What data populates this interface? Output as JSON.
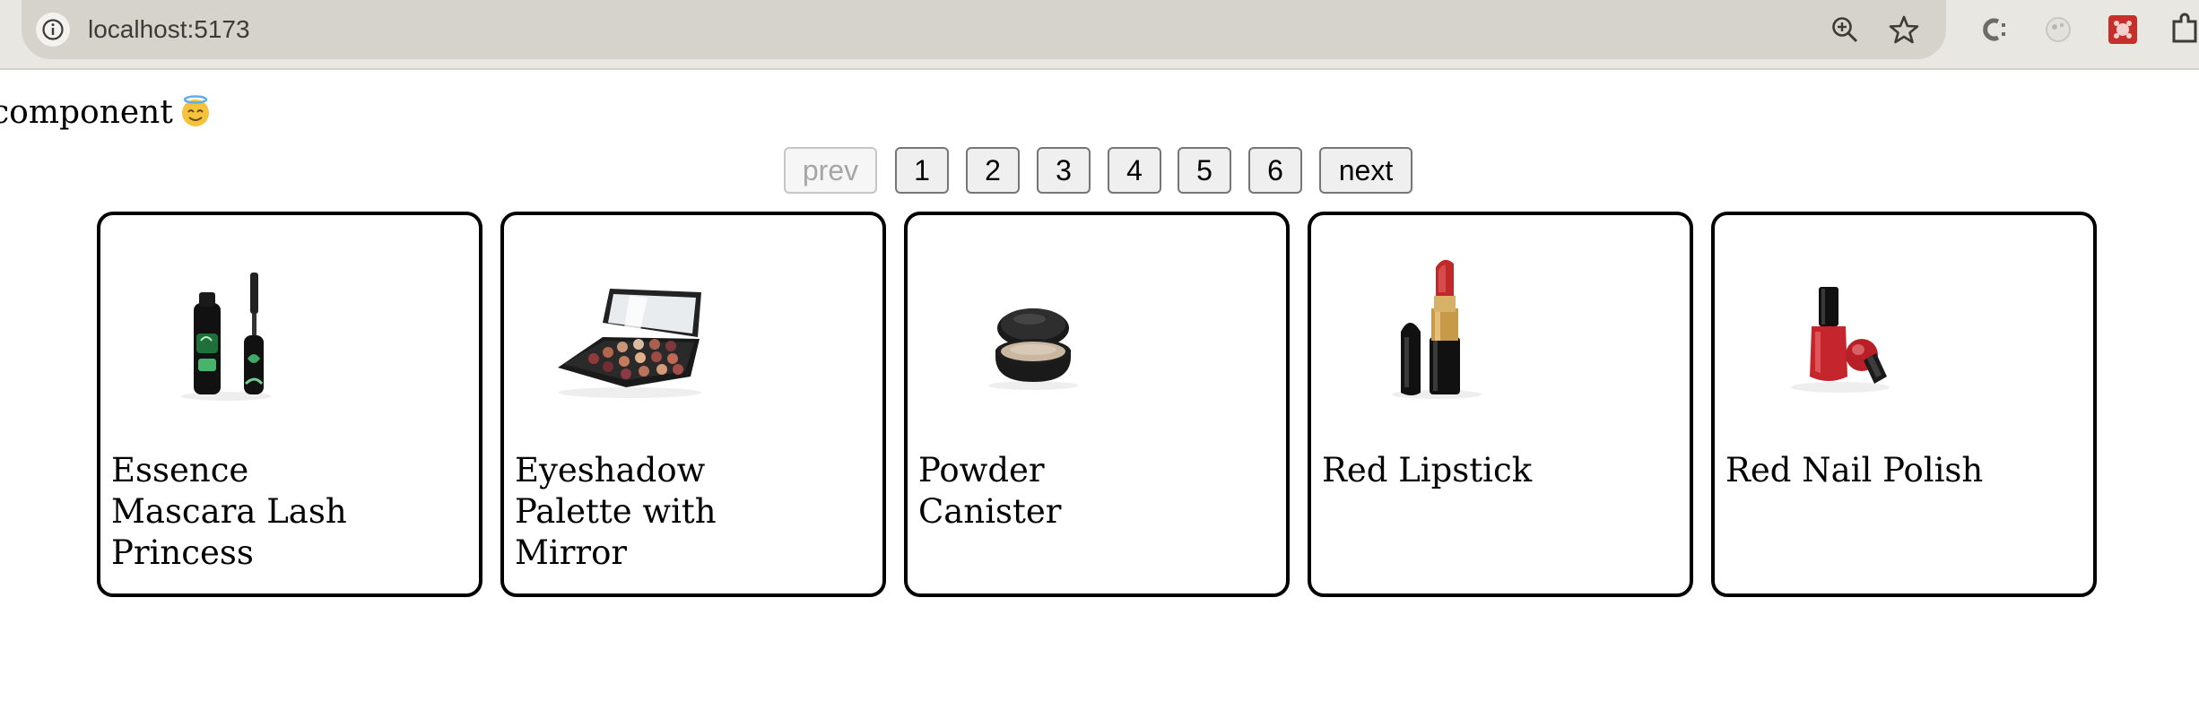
{
  "browser": {
    "url": "localhost:5173",
    "icons": [
      "info-icon",
      "zoom-icon",
      "bookmark-star-icon",
      "extension-c-icon",
      "extension-circle-icon",
      "extension-red-icon",
      "extensions-puzzle-icon"
    ]
  },
  "page": {
    "heading_text": "component",
    "heading_emoji": "😇",
    "pagination": {
      "prev": "prev",
      "next": "next",
      "pages": [
        "1",
        "2",
        "3",
        "4",
        "5",
        "6"
      ],
      "prev_disabled": true
    },
    "products": [
      {
        "title": "Essence Mascara Lash Princess",
        "icon": "mascara-image"
      },
      {
        "title": "Eyeshadow Palette with Mirror",
        "icon": "eyeshadow-palette-image"
      },
      {
        "title": "Powder Canister",
        "icon": "powder-canister-image"
      },
      {
        "title": "Red Lipstick",
        "icon": "lipstick-image"
      },
      {
        "title": "Red Nail Polish",
        "icon": "nail-polish-image"
      }
    ]
  }
}
